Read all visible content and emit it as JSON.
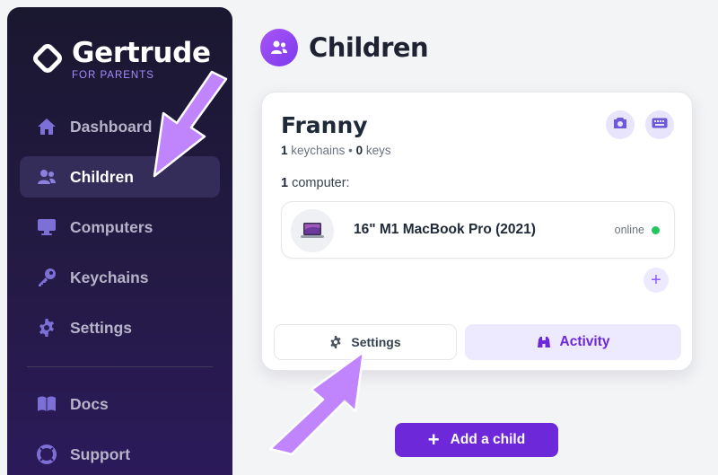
{
  "brand": {
    "name": "Gertrude",
    "tagline": "FOR PARENTS"
  },
  "sidebar": {
    "items": [
      {
        "label": "Dashboard",
        "icon": "home-icon"
      },
      {
        "label": "Children",
        "icon": "users-icon",
        "active": true
      },
      {
        "label": "Computers",
        "icon": "monitor-icon"
      },
      {
        "label": "Keychains",
        "icon": "key-icon"
      },
      {
        "label": "Settings",
        "icon": "gear-icon"
      }
    ],
    "secondary": [
      {
        "label": "Docs",
        "icon": "book-icon"
      },
      {
        "label": "Support",
        "icon": "lifebuoy-icon"
      }
    ]
  },
  "page": {
    "title": "Children",
    "icon": "users-icon"
  },
  "child_card": {
    "name": "Franny",
    "keychains_count": "1",
    "keychains_label": "keychains",
    "separator": "•",
    "keys_count": "0",
    "keys_label": "keys",
    "computers_count": "1",
    "computers_label": "computer:",
    "computer": {
      "name": "16\" M1 MacBook Pro (2021)",
      "status": "online",
      "status_color": "#22c55e"
    },
    "settings_label": "Settings",
    "activity_label": "Activity"
  },
  "add_child_label": "Add a child",
  "colors": {
    "accent": "#6d28d9",
    "accent_light": "#ede9fe",
    "annotation_arrow": "#c084fc",
    "sidebar_bg": "#1a1730"
  }
}
